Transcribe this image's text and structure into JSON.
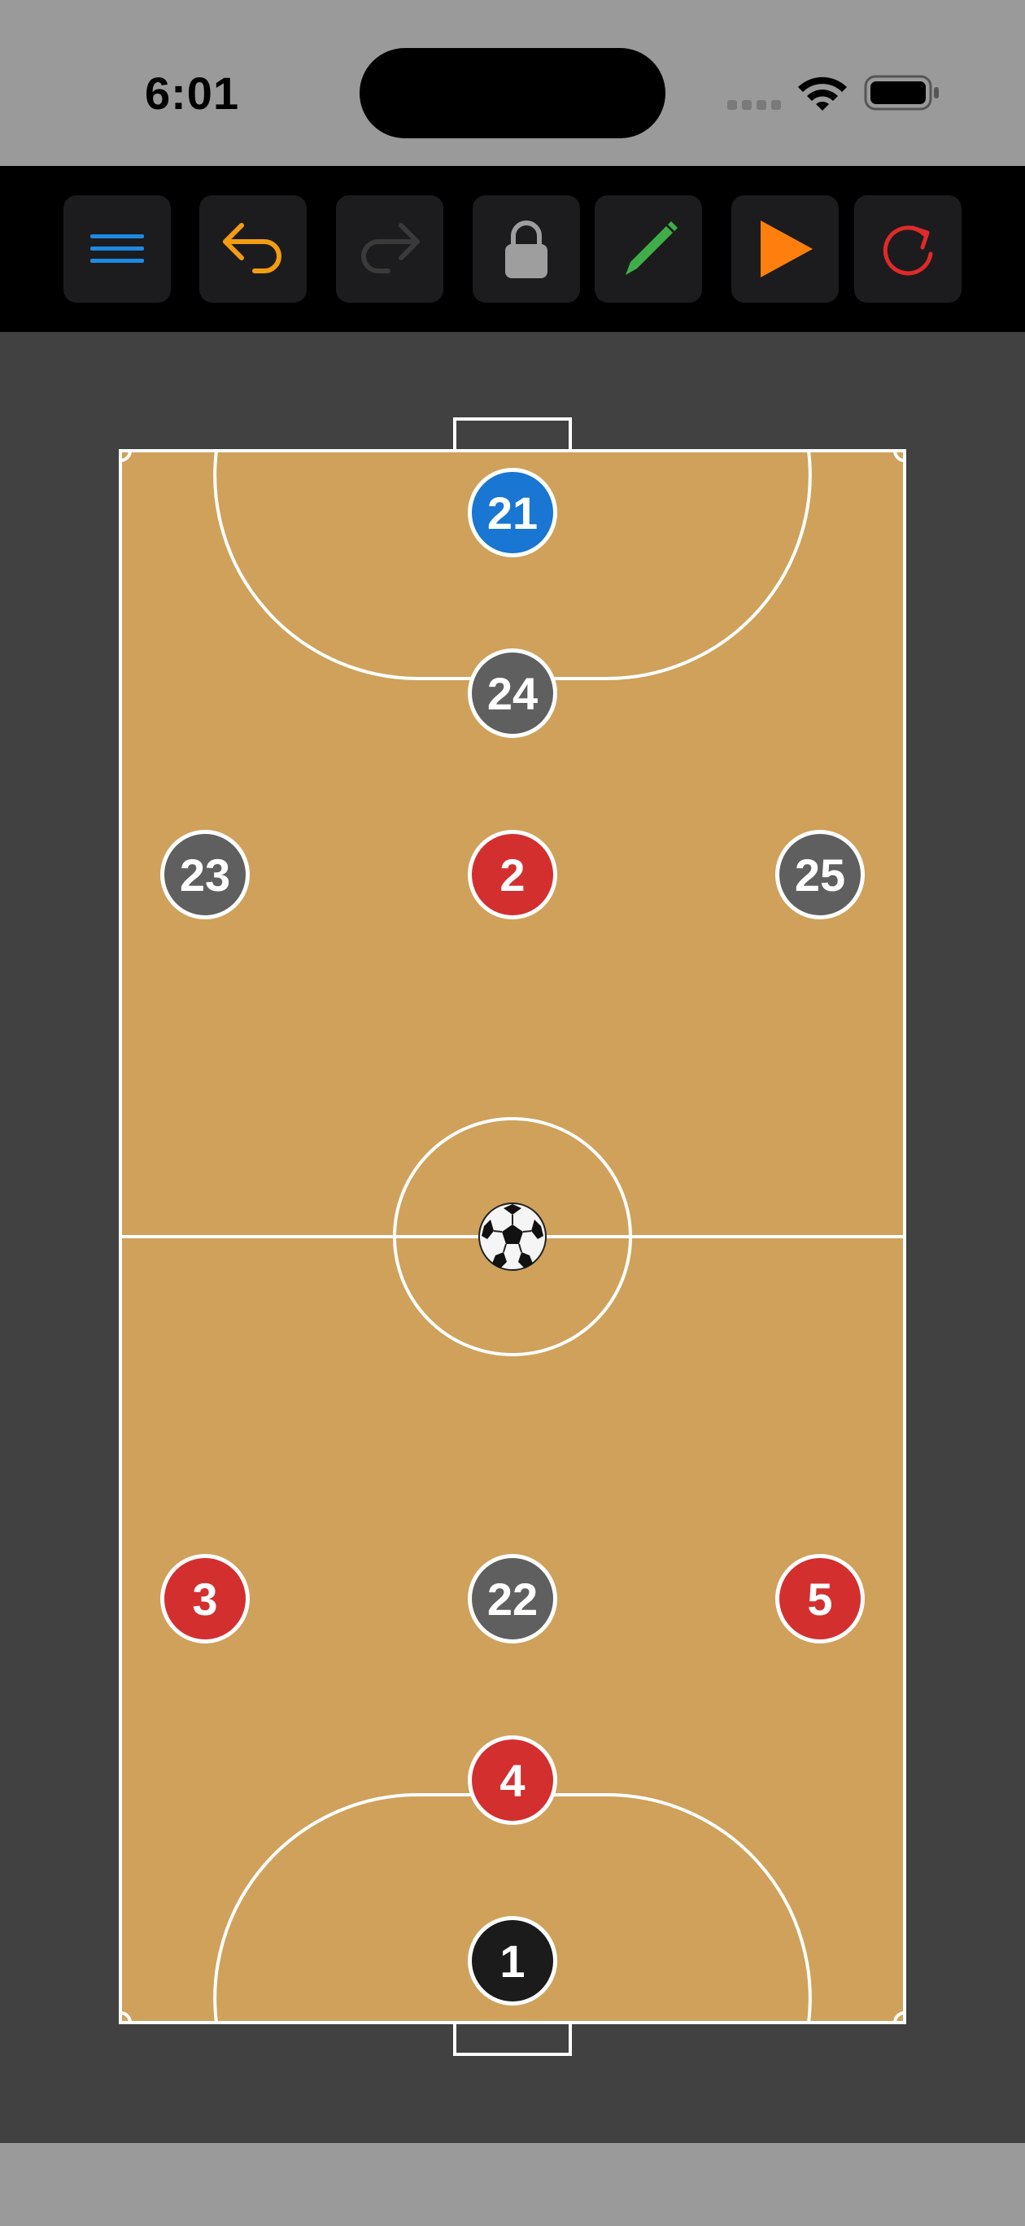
{
  "status": {
    "time": "6:01",
    "icons": [
      "signal-dots-icon",
      "wifi-icon",
      "battery-icon"
    ]
  },
  "toolbar": {
    "buttons": [
      {
        "name": "menu-button",
        "icon": "hamburger-menu-icon",
        "color": "#1e88e5"
      },
      {
        "name": "undo-button",
        "icon": "undo-arrow-icon",
        "color": "#f39c12"
      },
      {
        "name": "redo-button",
        "icon": "redo-arrow-icon",
        "color": "#3a3a3a"
      },
      {
        "name": "lock-button",
        "icon": "lock-icon",
        "color": "#9e9e9e"
      },
      {
        "name": "draw-button",
        "icon": "pencil-icon",
        "color": "#3fae49"
      },
      {
        "name": "play-button",
        "icon": "play-icon",
        "color": "#ff7f0e"
      },
      {
        "name": "reset-button",
        "icon": "refresh-icon",
        "color": "#e02a2a"
      }
    ]
  },
  "court": {
    "surface_color": "#cfa15b",
    "background_color": "#414141",
    "line_color": "#ffffff"
  },
  "players": [
    {
      "number": "21",
      "team": "goalkeeper-blue",
      "color": "#1976d2"
    },
    {
      "number": "24",
      "team": "grey",
      "color": "#5f5f5f"
    },
    {
      "number": "23",
      "team": "grey",
      "color": "#5f5f5f"
    },
    {
      "number": "2",
      "team": "red",
      "color": "#d32f2f"
    },
    {
      "number": "25",
      "team": "grey",
      "color": "#5f5f5f"
    },
    {
      "number": "3",
      "team": "red",
      "color": "#d32f2f"
    },
    {
      "number": "22",
      "team": "grey",
      "color": "#5f5f5f"
    },
    {
      "number": "5",
      "team": "red",
      "color": "#d32f2f"
    },
    {
      "number": "4",
      "team": "red",
      "color": "#d32f2f"
    },
    {
      "number": "1",
      "team": "goalkeeper-black",
      "color": "#1b1b1b"
    }
  ],
  "ball": {
    "icon": "soccer-ball-icon"
  }
}
